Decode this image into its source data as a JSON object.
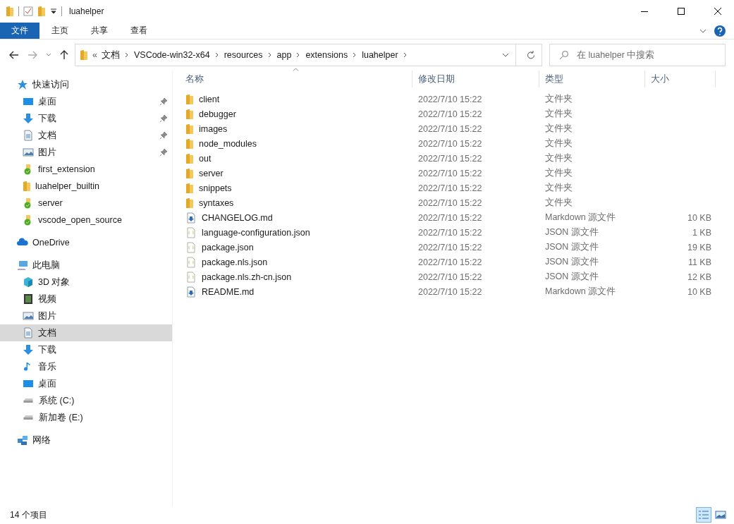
{
  "window": {
    "title": "luahelper"
  },
  "ribbon_tabs": [
    {
      "label": "文件",
      "selected": true
    },
    {
      "label": "主页",
      "selected": false
    },
    {
      "label": "共享",
      "selected": false
    },
    {
      "label": "查看",
      "selected": false
    }
  ],
  "address": {
    "overflow": "«",
    "segments": [
      "文档",
      "VSCode-win32-x64",
      "resources",
      "app",
      "extensions",
      "luahelper"
    ]
  },
  "search": {
    "placeholder": "在 luahelper 中搜索"
  },
  "sidebar": [
    {
      "label": "快速访问",
      "kind": "star",
      "children": [
        {
          "label": "桌面",
          "kind": "desktop",
          "pinned": true,
          "selected": false
        },
        {
          "label": "下载",
          "kind": "download",
          "pinned": true,
          "selected": false
        },
        {
          "label": "文档",
          "kind": "document",
          "pinned": true,
          "selected": false
        },
        {
          "label": "图片",
          "kind": "picture",
          "pinned": true,
          "selected": false
        },
        {
          "label": "first_extension",
          "kind": "synced",
          "pinned": false,
          "selected": false
        },
        {
          "label": "luahelper_builtin",
          "kind": "folder",
          "pinned": false,
          "selected": false
        },
        {
          "label": "server",
          "kind": "synced",
          "pinned": false,
          "selected": false
        },
        {
          "label": "vscode_open_source",
          "kind": "synced",
          "pinned": false,
          "selected": false
        }
      ]
    },
    {
      "label": "OneDrive",
      "kind": "cloud"
    },
    {
      "label": "此电脑",
      "kind": "pc",
      "children": [
        {
          "label": "3D 对象",
          "kind": "cube",
          "pinned": false,
          "selected": false
        },
        {
          "label": "视频",
          "kind": "video",
          "pinned": false,
          "selected": false
        },
        {
          "label": "图片",
          "kind": "picture",
          "pinned": false,
          "selected": false
        },
        {
          "label": "文档",
          "kind": "document",
          "pinned": false,
          "selected": true
        },
        {
          "label": "下载",
          "kind": "download",
          "pinned": false,
          "selected": false
        },
        {
          "label": "音乐",
          "kind": "music",
          "pinned": false,
          "selected": false
        },
        {
          "label": "桌面",
          "kind": "desktop",
          "pinned": false,
          "selected": false
        },
        {
          "label": "系统 (C:)",
          "kind": "drive",
          "pinned": false,
          "selected": false
        },
        {
          "label": "新加卷 (E:)",
          "kind": "drive",
          "pinned": false,
          "selected": false
        }
      ]
    },
    {
      "label": "网络",
      "kind": "network"
    }
  ],
  "table": {
    "columns": [
      "名称",
      "修改日期",
      "类型",
      "大小"
    ],
    "rows": [
      {
        "kind": "folder",
        "name": "client",
        "date": "2022/7/10 15:22",
        "type": "文件夹"
      },
      {
        "kind": "folder",
        "name": "debugger",
        "date": "2022/7/10 15:22",
        "type": "文件夹"
      },
      {
        "kind": "folder",
        "name": "images",
        "date": "2022/7/10 15:22",
        "type": "文件夹"
      },
      {
        "kind": "folder",
        "name": "node_modules",
        "date": "2022/7/10 15:22",
        "type": "文件夹"
      },
      {
        "kind": "folder",
        "name": "out",
        "date": "2022/7/10 15:22",
        "type": "文件夹"
      },
      {
        "kind": "folder",
        "name": "server",
        "date": "2022/7/10 15:22",
        "type": "文件夹"
      },
      {
        "kind": "folder",
        "name": "snippets",
        "date": "2022/7/10 15:22",
        "type": "文件夹"
      },
      {
        "kind": "folder",
        "name": "syntaxes",
        "date": "2022/7/10 15:22",
        "type": "文件夹"
      },
      {
        "kind": "markdown",
        "name": "CHANGELOG.md",
        "date": "2022/7/10 15:22",
        "type": "Markdown 源文件",
        "size": "10 KB"
      },
      {
        "kind": "json",
        "name": "language-configuration.json",
        "date": "2022/7/10 15:22",
        "type": "JSON 源文件",
        "size": "1 KB"
      },
      {
        "kind": "json",
        "name": "package.json",
        "date": "2022/7/10 15:22",
        "type": "JSON 源文件",
        "size": "19 KB"
      },
      {
        "kind": "json",
        "name": "package.nls.json",
        "date": "2022/7/10 15:22",
        "type": "JSON 源文件",
        "size": "11 KB"
      },
      {
        "kind": "json",
        "name": "package.nls.zh-cn.json",
        "date": "2022/7/10 15:22",
        "type": "JSON 源文件",
        "size": "12 KB"
      },
      {
        "kind": "markdown",
        "name": "README.md",
        "date": "2022/7/10 15:22",
        "type": "Markdown 源文件",
        "size": "10 KB"
      }
    ]
  },
  "status_bar": {
    "count": "14 个项目"
  }
}
